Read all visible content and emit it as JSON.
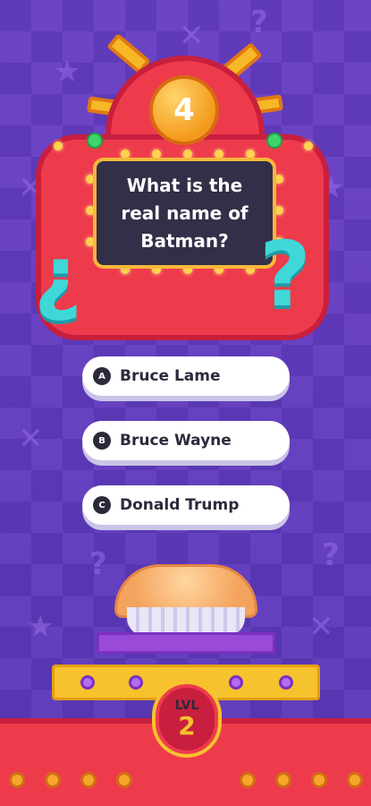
{
  "question": {
    "number": "4",
    "text": "What is the real name of Batman?"
  },
  "answers": [
    {
      "letter": "A",
      "text": "Bruce Lame"
    },
    {
      "letter": "B",
      "text": "Bruce Wayne"
    },
    {
      "letter": "C",
      "text": "Donald Trump"
    }
  ],
  "level": {
    "label": "LVL",
    "value": "2"
  },
  "colors": {
    "background": "#5a3bb4",
    "board": "#ee3b4c",
    "screen": "#332f48",
    "accent_yellow": "#f6c22d",
    "cyan_symbol": "#3fd7d8"
  },
  "icons": {
    "question_symbols": [
      "inverted-question-mark-icon",
      "question-mark-icon"
    ],
    "pie": "pie-icon"
  }
}
